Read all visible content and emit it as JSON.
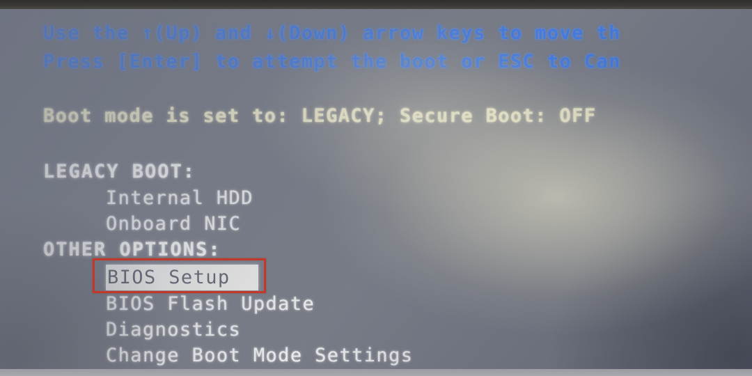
{
  "screen": {
    "kind": "bios-boot-menu",
    "background_color": "#767a86",
    "edge_top_color": "#2e2d2c",
    "edge_bottom_color": "#9a9ca2"
  },
  "hints": {
    "color": "#3f79e4",
    "line1": "Use the ↑(Up) and ↓(Down) arrow keys to move th",
    "line2": "Press [Enter] to attempt the boot or ESC to Can"
  },
  "boot_mode": {
    "color": "#f3f0cf",
    "text": "Boot mode is set to: LEGACY; Secure Boot: OFF",
    "mode_value": "LEGACY",
    "secure_boot_value": "OFF"
  },
  "legacy_boot": {
    "heading": "LEGACY BOOT:",
    "items": [
      {
        "label": "Internal HDD",
        "selected": false
      },
      {
        "label": "Onboard NIC",
        "selected": false
      }
    ]
  },
  "other_options": {
    "heading": "OTHER OPTIONS:",
    "items": [
      {
        "label": "BIOS Setup",
        "selected": true
      },
      {
        "label": "BIOS Flash Update",
        "selected": false
      },
      {
        "label": "Diagnostics",
        "selected": false
      },
      {
        "label": "Change Boot Mode Settings",
        "selected": false
      }
    ]
  },
  "annotation": {
    "target": "BIOS Setup",
    "shape": "rectangle",
    "color": "#c0392b",
    "border_width_px": 3
  }
}
